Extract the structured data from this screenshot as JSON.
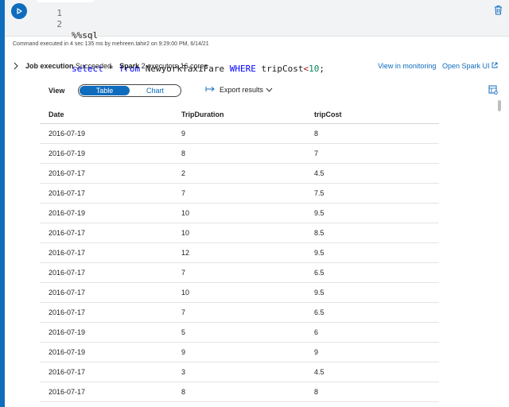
{
  "code": {
    "line_numbers": [
      "1",
      "2"
    ],
    "line1": "%%sql",
    "line2_kw1": "select",
    "line2_star": " * ",
    "line2_kw2": "from",
    "line2_table": " NewyorkTaxiFare ",
    "line2_kw3": "WHERE",
    "line2_col": " tripCost",
    "line2_op": "<",
    "line2_num": "10",
    "line2_end": ";"
  },
  "execution_info": "Command executed in 4 sec 135 ms by mehreen.tahir2 on 9:29:00 PM, 6/14/21",
  "job": {
    "label": "Job execution",
    "status": "Succeeded",
    "spark_label": "Spark",
    "spark_info": "2 executors 16 cores",
    "monitor_link": "View in monitoring",
    "spark_ui_link": "Open Spark UI"
  },
  "view": {
    "label": "View",
    "tab_table": "Table",
    "tab_chart": "Chart",
    "export_label": "Export results"
  },
  "table": {
    "columns": [
      "Date",
      "TripDuration",
      "tripCost"
    ],
    "rows": [
      [
        "2016-07-19",
        "9",
        "8"
      ],
      [
        "2016-07-19",
        "8",
        "7"
      ],
      [
        "2016-07-17",
        "2",
        "4.5"
      ],
      [
        "2016-07-17",
        "7",
        "7.5"
      ],
      [
        "2016-07-19",
        "10",
        "9.5"
      ],
      [
        "2016-07-17",
        "10",
        "8.5"
      ],
      [
        "2016-07-17",
        "12",
        "9.5"
      ],
      [
        "2016-07-17",
        "7",
        "6.5"
      ],
      [
        "2016-07-17",
        "10",
        "9.5"
      ],
      [
        "2016-07-17",
        "7",
        "6.5"
      ],
      [
        "2016-07-19",
        "5",
        "6"
      ],
      [
        "2016-07-19",
        "9",
        "9"
      ],
      [
        "2016-07-17",
        "3",
        "4.5"
      ],
      [
        "2016-07-17",
        "8",
        "8"
      ]
    ]
  },
  "icons": {
    "run": "play-icon",
    "delete": "trash-icon",
    "expand": "chevron-right-icon",
    "external": "external-link-icon",
    "export": "arrow-right-icon",
    "dropdown": "chevron-down-icon",
    "settings": "table-settings-icon"
  },
  "colors": {
    "accent": "#0f6cbd"
  }
}
